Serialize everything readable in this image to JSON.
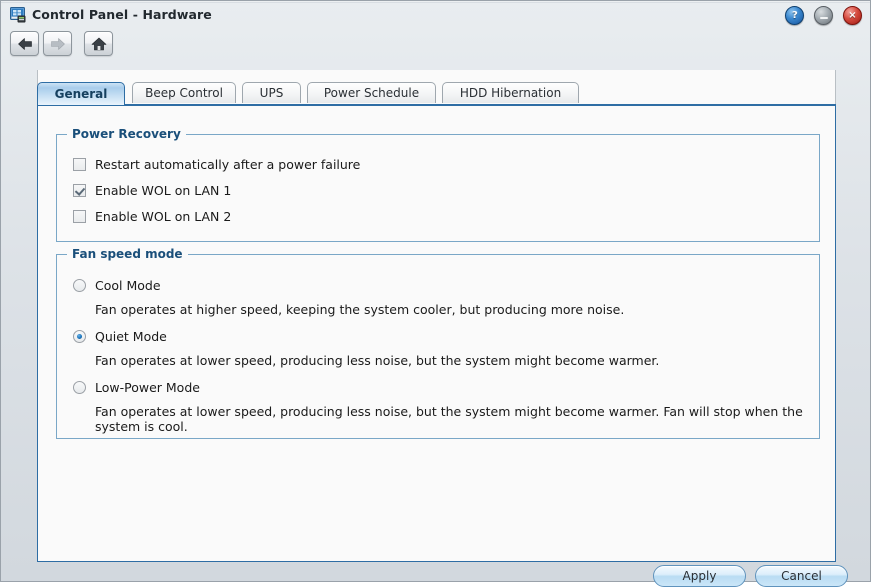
{
  "window": {
    "title": "Control Panel - Hardware",
    "icon": "control-panel-icon",
    "controls": {
      "help_label": "?",
      "minimize_label": "",
      "close_label": "×"
    }
  },
  "toolbar": {
    "back_label": "back-arrow-icon",
    "forward_label": "forward-arrow-icon",
    "home_label": "home-icon"
  },
  "tabs": [
    {
      "label": "General",
      "active": true
    },
    {
      "label": "Beep Control",
      "active": false
    },
    {
      "label": "UPS",
      "active": false
    },
    {
      "label": "Power Schedule",
      "active": false
    },
    {
      "label": "HDD Hibernation",
      "active": false
    }
  ],
  "power_recovery": {
    "legend": "Power Recovery",
    "options": [
      {
        "label": "Restart automatically after a power failure",
        "checked": false
      },
      {
        "label": "Enable WOL on LAN 1",
        "checked": true
      },
      {
        "label": "Enable WOL on LAN 2",
        "checked": false
      }
    ]
  },
  "fan_speed_mode": {
    "legend": "Fan speed mode",
    "options": [
      {
        "label": "Cool Mode",
        "selected": false,
        "description": "Fan operates at higher speed, keeping the system cooler, but producing more noise."
      },
      {
        "label": "Quiet Mode",
        "selected": true,
        "description": "Fan operates at lower speed, producing less noise, but the system might become warmer."
      },
      {
        "label": "Low-Power Mode",
        "selected": false,
        "description": "Fan operates at lower speed, producing less noise, but the system might become warmer. Fan will stop when the system is cool."
      }
    ]
  },
  "footer": {
    "apply_label": "Apply",
    "cancel_label": "Cancel"
  },
  "colors": {
    "accent_blue": "#2e6da4",
    "legend_blue": "#1a4f7a",
    "fieldset_border": "#7aa7c7",
    "close_red": "#d64a3e",
    "help_blue": "#3b88cf"
  }
}
